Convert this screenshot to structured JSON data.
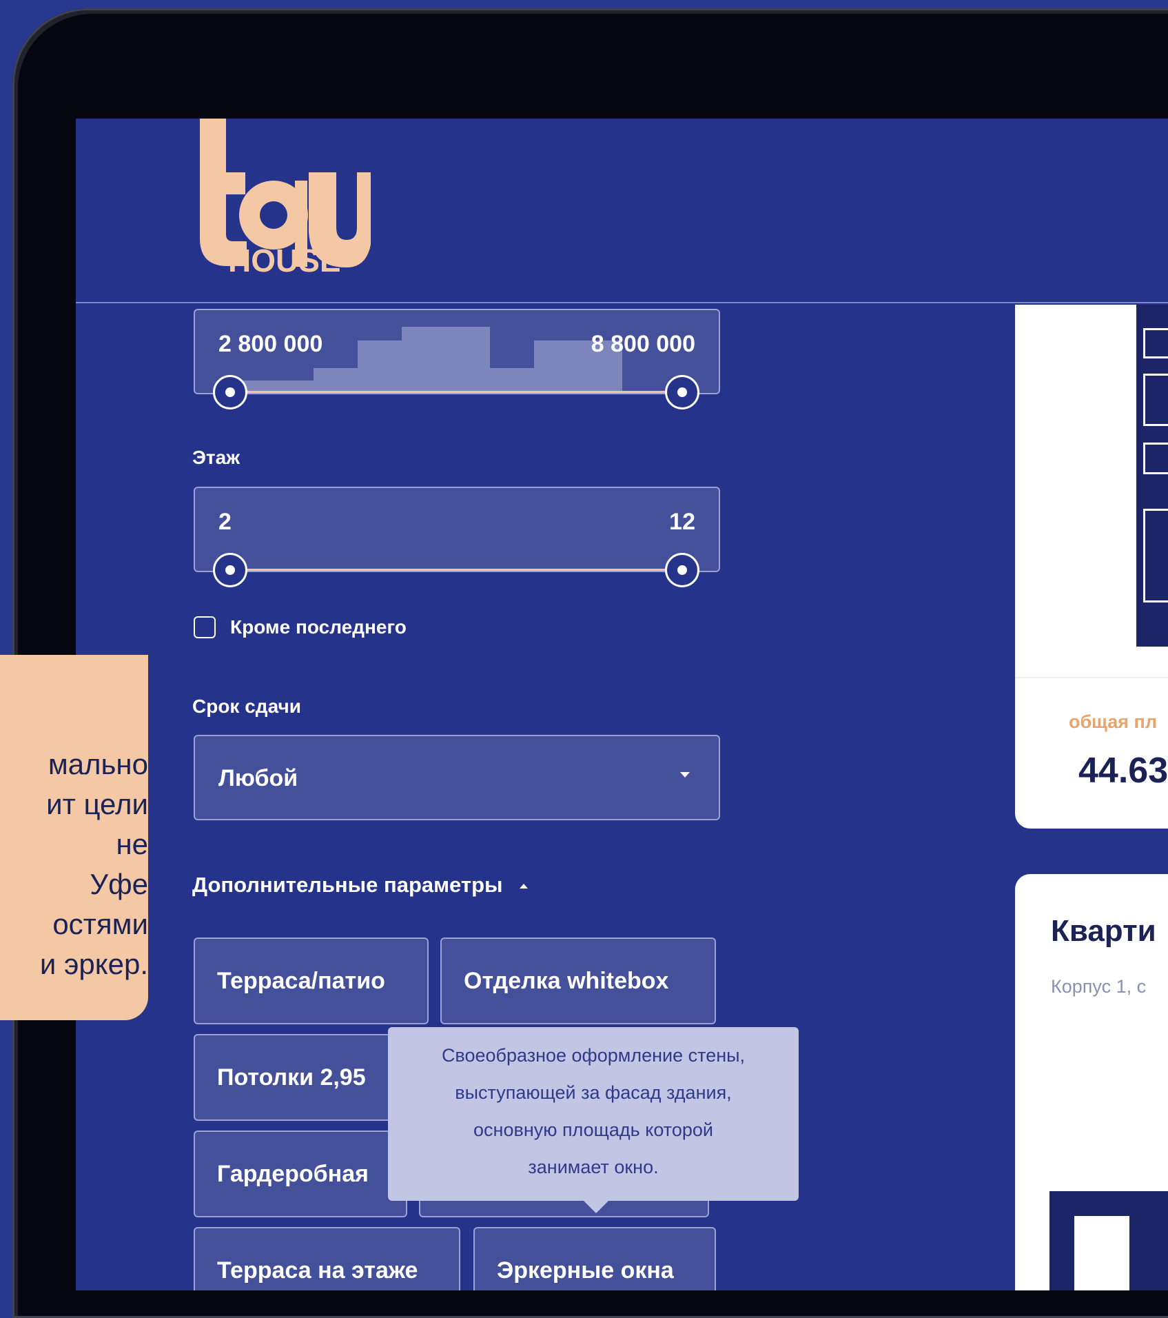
{
  "logo": {
    "word": "tau",
    "sub": "HOUSE",
    "mark": "®"
  },
  "price_filter": {
    "min": "2 800 000",
    "max": "8 800 000"
  },
  "floor_filter": {
    "label": "Этаж",
    "min": "2",
    "max": "12"
  },
  "except_last": {
    "label": "Кроме последнего",
    "checked": false
  },
  "deadline": {
    "label": "Срок сдачи",
    "value": "Любой"
  },
  "extra": {
    "label": "Дополнительные параметры"
  },
  "chips": {
    "terrace": "Терраса/патио",
    "whitebox": "Отделка whitebox",
    "ceilings": "Потолки 2,95",
    "wardrobe": "Гардеробная",
    "terrace_floor": "Терраса на этаже",
    "bay_windows": "Эркерные окна"
  },
  "tooltip": {
    "lines": [
      "Своеобразное оформление стены,",
      "выступающей за фасад здания,",
      "основную площадь которой",
      "занимает окно."
    ]
  },
  "area_card": {
    "label": "общая пл",
    "value": "44.63"
  },
  "apartment_card": {
    "title": "Кварти",
    "subtitle": "Корпус 1, с"
  },
  "promo_text": {
    "lines": [
      "мально",
      "ит цели",
      "не",
      "Уфе",
      "остями",
      "и эркер."
    ]
  },
  "colors": {
    "bg": "#27388e",
    "screen": "#25338a",
    "accent": "#f5c8a5",
    "field": "#44509a"
  }
}
